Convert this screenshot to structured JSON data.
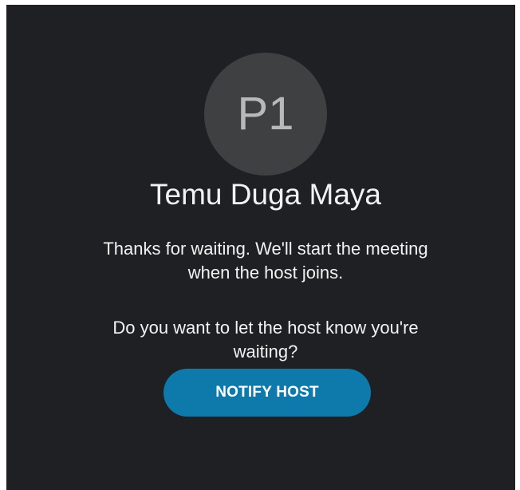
{
  "avatar": {
    "initials": "P1"
  },
  "meeting": {
    "title": "Temu Duga Maya"
  },
  "messages": {
    "waiting_line1": "Thanks for waiting. We'll start the meeting",
    "waiting_line2": "when the host joins.",
    "notify_prompt_line1": "Do you want to let the host know you're",
    "notify_prompt_line2": "waiting?"
  },
  "actions": {
    "notify_host_label": "NOTIFY HOST"
  },
  "colors": {
    "background": "#1e2023",
    "avatar_bg": "#3f4042",
    "button_bg": "#0e7aab"
  }
}
